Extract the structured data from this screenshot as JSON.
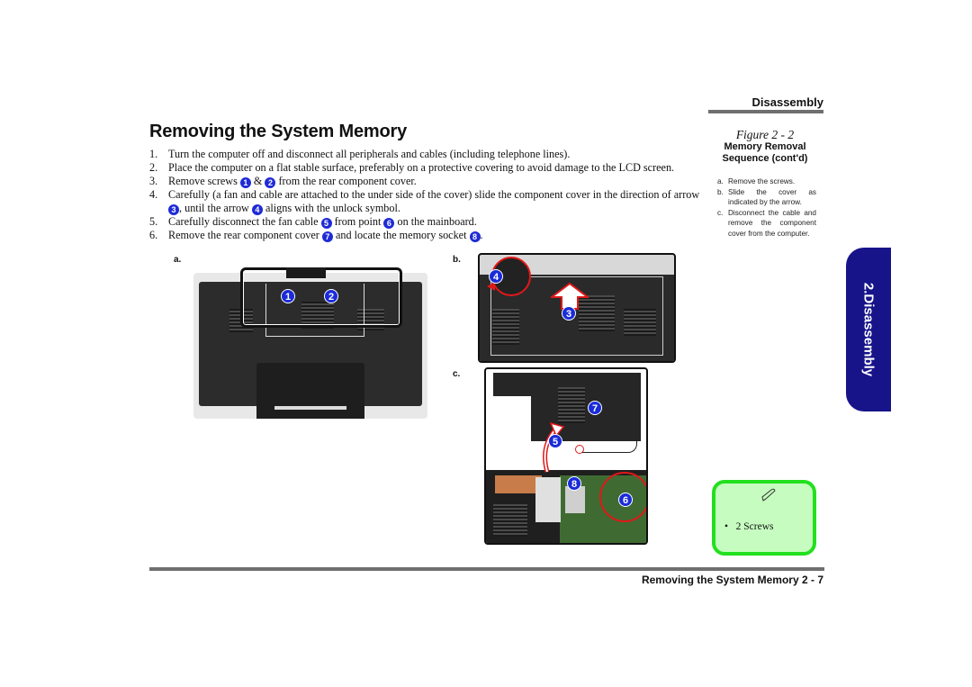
{
  "header": {
    "section": "Disassembly"
  },
  "page_title": "Removing the System Memory",
  "steps": [
    {
      "n": "1.",
      "parts": [
        "Turn the computer off and disconnect all peripherals and cables (including telephone lines)."
      ]
    },
    {
      "n": "2.",
      "parts": [
        "Place the computer on a flat stable surface, preferably on a protective covering to avoid damage to the LCD screen."
      ]
    },
    {
      "n": "3.",
      "parts": [
        "Remove screws ",
        {
          "badge": "1"
        },
        " & ",
        {
          "badge": "2"
        },
        " from the rear component cover."
      ]
    },
    {
      "n": "4.",
      "parts": [
        "Carefully (a fan and cable are attached to the under side of the cover) slide the component cover in the direction of arrow ",
        {
          "badge": "3"
        },
        ", until the arrow ",
        {
          "badge": "4"
        },
        " aligns with the unlock symbol."
      ]
    },
    {
      "n": "5.",
      "parts": [
        "Carefully disconnect the fan cable ",
        {
          "badge": "5"
        },
        " from point ",
        {
          "badge": "6"
        },
        " on the mainboard."
      ]
    },
    {
      "n": "6.",
      "parts": [
        "Remove the rear component cover ",
        {
          "badge": "7"
        },
        " and locate the memory socket ",
        {
          "badge": "8"
        },
        "."
      ]
    }
  ],
  "figure": {
    "label": "Figure 2 - 2",
    "title_line1": "Memory Removal",
    "title_line2": "Sequence (cont'd)",
    "steps": [
      {
        "letter": "a.",
        "text": "Remove the screws."
      },
      {
        "letter": "b.",
        "text": "Slide the cover as indicated by the arrow."
      },
      {
        "letter": "c.",
        "text": "Disconnect the cable and remove the component cover from the computer."
      }
    ],
    "panels": {
      "a": {
        "label": "a.",
        "callouts": [
          "1",
          "2"
        ]
      },
      "b": {
        "label": "b.",
        "callouts": [
          "3",
          "4"
        ]
      },
      "c": {
        "label": "c.",
        "callouts": [
          "5",
          "6",
          "7",
          "8"
        ]
      }
    }
  },
  "side_tab": {
    "label": "2.Disassembly"
  },
  "note": {
    "icon": "pencil-icon",
    "items": [
      "2 Screws"
    ]
  },
  "footer": {
    "text": "Removing the System Memory  2  -  7"
  },
  "colors": {
    "tab": "#17148a",
    "badge": "#1f2bd6",
    "note_border": "#22e01e",
    "note_bg": "#c6fcc0",
    "rule": "#6f6f6f",
    "highlight_red": "#e01818"
  }
}
